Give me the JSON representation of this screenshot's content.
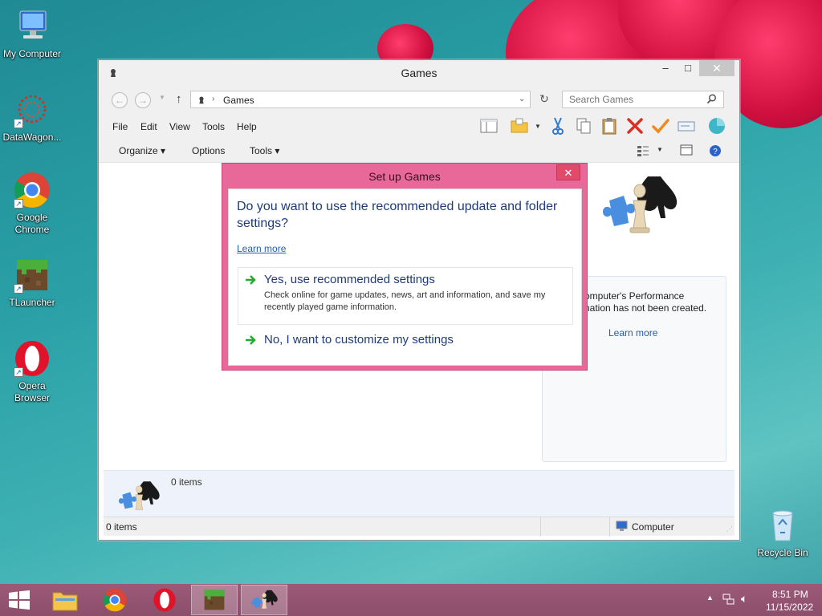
{
  "desktop": {
    "icons": [
      {
        "label": "My Computer"
      },
      {
        "label": "DataWagon..."
      },
      {
        "label": "Google Chrome"
      },
      {
        "label": "TLauncher"
      },
      {
        "label": "Opera Browser"
      },
      {
        "label": "Recycle Bin"
      }
    ]
  },
  "window": {
    "title": "Games",
    "controls": {
      "minimize": "–",
      "maximize": "□",
      "close": "✕"
    },
    "address": {
      "crumb": "Games"
    },
    "search": {
      "placeholder": "Search Games"
    },
    "menu": [
      "File",
      "Edit",
      "View",
      "Tools",
      "Help"
    ],
    "commands": {
      "organize": "Organize",
      "options": "Options",
      "tools": "Tools"
    },
    "side_panel": {
      "line1": "omputer's Performance",
      "line2": "nation has not been created.",
      "link": "Learn more"
    },
    "details": {
      "count": "0 items"
    },
    "status": {
      "left": "0 items",
      "right": "Computer"
    }
  },
  "dialog": {
    "title": "Set up Games",
    "close": "✕",
    "question": "Do you want to use the recommended update and folder settings?",
    "learn_more": "Learn more",
    "options": [
      {
        "title": "Yes, use recommended settings",
        "desc": "Check online for game updates, news, art and information, and save my recently played game information."
      },
      {
        "title": "No, I want to customize my settings",
        "desc": ""
      }
    ]
  },
  "taskbar": {
    "time": "8:51 PM",
    "date": "11/15/2022"
  },
  "colors": {
    "dialog_frame": "#e8689a",
    "link": "#1f5fb3",
    "heading": "#1e3a78",
    "taskbar": "#8b4e6b"
  }
}
